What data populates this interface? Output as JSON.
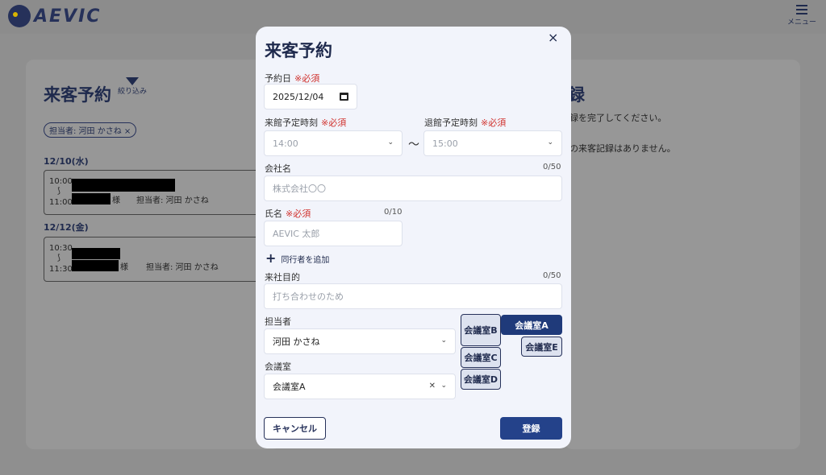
{
  "app": {
    "logo_text": "AEVIC",
    "menu_label": "メニュー"
  },
  "background": {
    "left_title": "来客予約",
    "filter_label": "絞り込み",
    "filter_chip": "担当者: 河田 かさね ×",
    "schedule": [
      {
        "date": "12/10(水)",
        "start": "10:00",
        "sep": "⟆",
        "end": "11:00",
        "sama": "様",
        "tanto": "担当者: 河田 かさね"
      },
      {
        "date": "12/12(金)",
        "start": "10:30",
        "sep": "⟆",
        "end": "11:30",
        "sama": "様",
        "tanto": "担当者: 河田 かさね"
      }
    ],
    "right_title": "録",
    "right_msg1": "録を完了してください。",
    "right_msg2": "の来客記録はありません。"
  },
  "modal": {
    "title": "来客予約",
    "close_icon": "×",
    "required_mark": "※必須",
    "date": {
      "label": "予約日",
      "value": "2025/12/04"
    },
    "arrival": {
      "label": "来館予定時刻",
      "placeholder": "14:00"
    },
    "departure": {
      "label": "退館予定時刻",
      "placeholder": "15:00"
    },
    "tilde": "〜",
    "company": {
      "label": "会社名",
      "counter": "0/50",
      "placeholder": "株式会社〇〇"
    },
    "name": {
      "label": "氏名",
      "counter": "0/10",
      "placeholder": "AEVIC 太郎"
    },
    "add_companion": "同行者を追加",
    "purpose": {
      "label": "来社目的",
      "counter": "0/50",
      "placeholder": "打ち合わせのため"
    },
    "staff": {
      "label": "担当者",
      "value": "河田 かさね"
    },
    "room": {
      "label": "会議室",
      "value": "会議室A"
    },
    "rooms": {
      "b": "会議室B",
      "c": "会議室C",
      "d": "会議室D",
      "a": "会議室A",
      "e": "会議室E"
    },
    "cancel_label": "キャンセル",
    "submit_label": "登録"
  },
  "colors": {
    "brand": "#1f2a4d",
    "primary": "#24428a",
    "required": "#d0312d"
  }
}
